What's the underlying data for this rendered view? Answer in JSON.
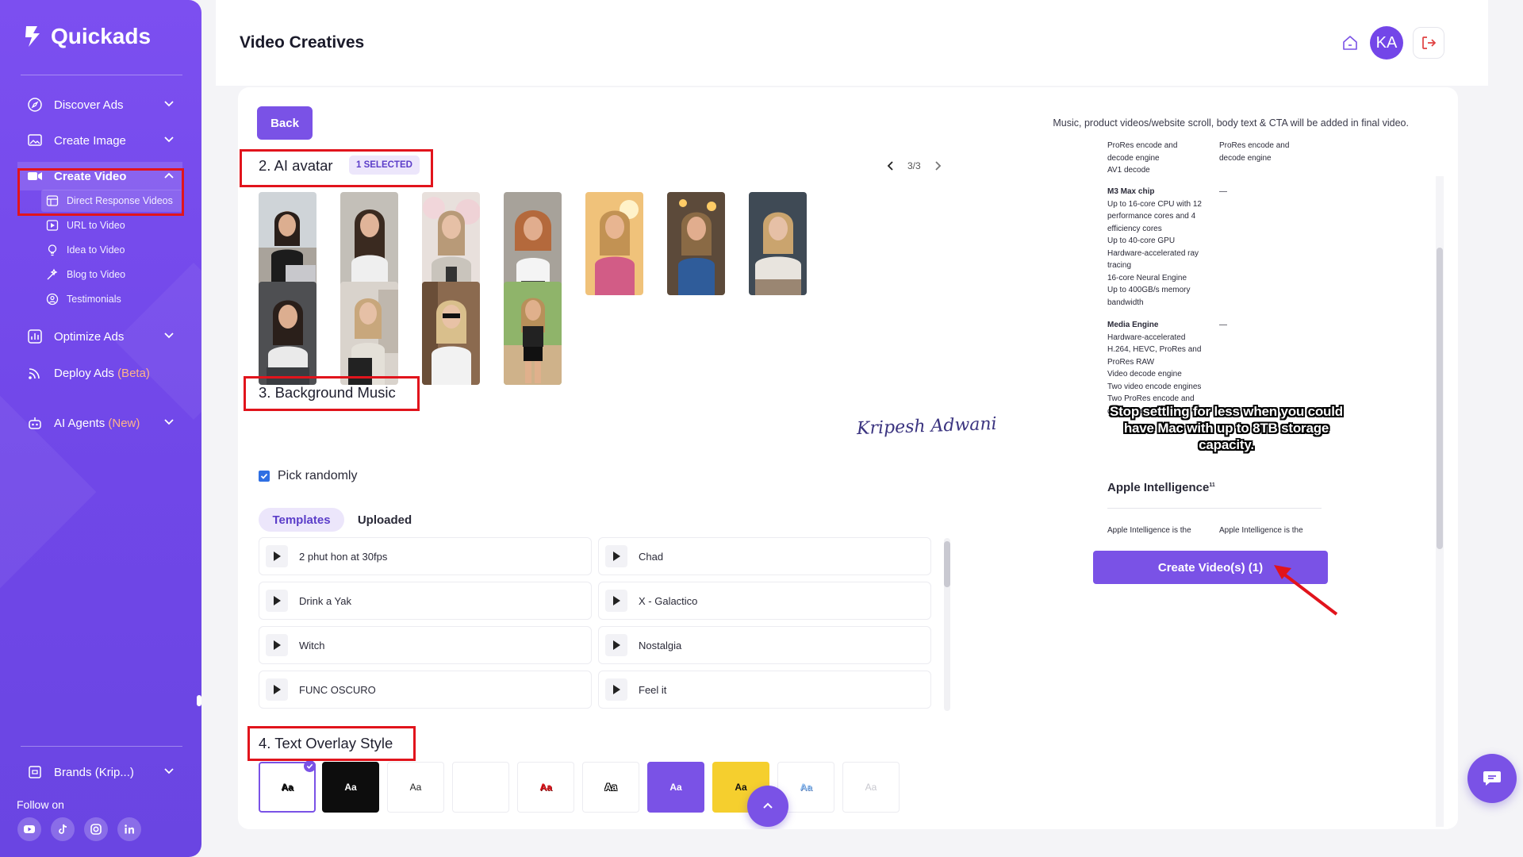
{
  "brand": {
    "name": "Quickads"
  },
  "sidebar": {
    "items": [
      {
        "label": "Discover Ads"
      },
      {
        "label": "Create Image"
      },
      {
        "label": "Create Video"
      },
      {
        "label": "Optimize Ads"
      },
      {
        "label": "Deploy Ads",
        "tag": "(Beta)"
      },
      {
        "label": "AI Agents",
        "tag": "(New)"
      }
    ],
    "video_sub_items": [
      {
        "label": "Direct Response Videos"
      },
      {
        "label": "URL to Video"
      },
      {
        "label": "Idea to Video"
      },
      {
        "label": "Blog to Video"
      },
      {
        "label": "Testimonials"
      }
    ],
    "brands_label": "Brands (Krip...)",
    "follow_label": "Follow on"
  },
  "header": {
    "title": "Video Creatives",
    "avatar_initials": "KA"
  },
  "main": {
    "back_label": "Back",
    "notice": "Music, product videos/website scroll, body text & CTA will be added in final video.",
    "avatar_section": {
      "title": "2. AI avatar",
      "badge": "1 SELECTED",
      "page": "3/3"
    },
    "music_section": {
      "title": "3. Background Music",
      "pick_randomly": "Pick randomly",
      "tabs": [
        "Templates",
        "Uploaded"
      ],
      "tracks": [
        "2 phut hon at 30fps",
        "Chad",
        "Drink a Yak",
        "X - Galactico",
        "Witch",
        "Nostalgia",
        "FUNC OSCURO",
        "Feel it"
      ]
    },
    "text_overlay_section": {
      "title": "4. Text Overlay Style",
      "styles": [
        "Aa",
        "Aa",
        "Aa",
        "",
        "Aa",
        "Aa",
        "Aa",
        "Aa",
        "Aa",
        "Aa"
      ]
    },
    "signature": "Kripesh Adwani"
  },
  "preview": {
    "spec_top_left": [
      "ProRes encode and",
      "decode engine",
      "AV1 decode"
    ],
    "spec_top_right": [
      "ProRes encode and",
      "decode engine"
    ],
    "chip_title": "M3 Max chip",
    "chip_lines": [
      "Up to 16-core CPU with 12",
      "performance cores and 4",
      "efficiency cores",
      "Up to 40-core GPU",
      "Hardware-accelerated ray",
      "tracing",
      "16-core Neural Engine",
      "Up to 400GB/s memory",
      "bandwidth"
    ],
    "media_title": "Media Engine",
    "media_lines": [
      "Hardware-accelerated",
      "H.264, HEVC, ProRes and",
      "ProRes RAW",
      "Video decode engine",
      "Two video encode engines",
      "Two ProRes encode and",
      "decode engines"
    ],
    "dash": "—",
    "overlay_text": "Stop settling for less when you could have Mac with up to 8TB storage capacity.",
    "ai_title": "Apple Intelligence",
    "ai_sup": "11",
    "ai_desc": "Apple Intelligence is the",
    "create_label": "Create Video(s) (1)"
  },
  "colors": {
    "brand_purple": "#7a52e6",
    "highlight_red": "#e1141c",
    "badge_bg": "#ece6fb"
  }
}
